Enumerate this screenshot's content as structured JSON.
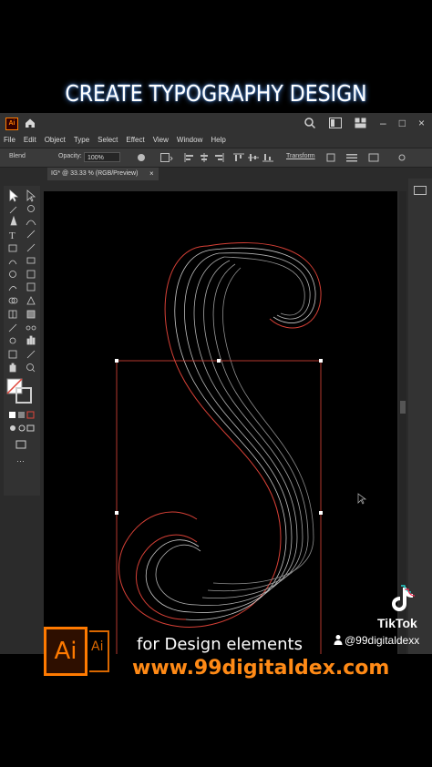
{
  "overlay": {
    "title": "CREATE TYPOGRAPHY DESIGN",
    "promo_text": "for Design elements",
    "url": "www.99digitaldex.com",
    "tiktok_label": "TikTok",
    "tiktok_handle": "@99digitaldexx",
    "ai_logo_text": "Ai",
    "ai_logo_text2": "Ai"
  },
  "app": {
    "logo_text": "Ai",
    "menu": [
      "File",
      "Edit",
      "Object",
      "Type",
      "Select",
      "Effect",
      "View",
      "Window",
      "Help"
    ],
    "control_bar": {
      "mode_label": "Blend",
      "opacity_label": "Opacity:",
      "opacity_value": "100%",
      "transform_label": "Transform"
    },
    "document_tab": {
      "title": "IG* @ 33.33 % (RGB/Preview)",
      "close": "×"
    }
  },
  "colors": {
    "accent_orange": "#ff8a16",
    "selection_red": "#e0453a",
    "glow_blue": "#5aa0ff"
  },
  "icons": [
    "home-icon",
    "search-icon",
    "workspace-icon",
    "arrange-icon",
    "selection-tool-icon",
    "direct-selection-tool-icon",
    "pen-tool-icon",
    "type-tool-icon",
    "rectangle-tool-icon",
    "brush-tool-icon",
    "hand-tool-icon",
    "zoom-tool-icon",
    "tiktok-icon",
    "user-icon"
  ]
}
